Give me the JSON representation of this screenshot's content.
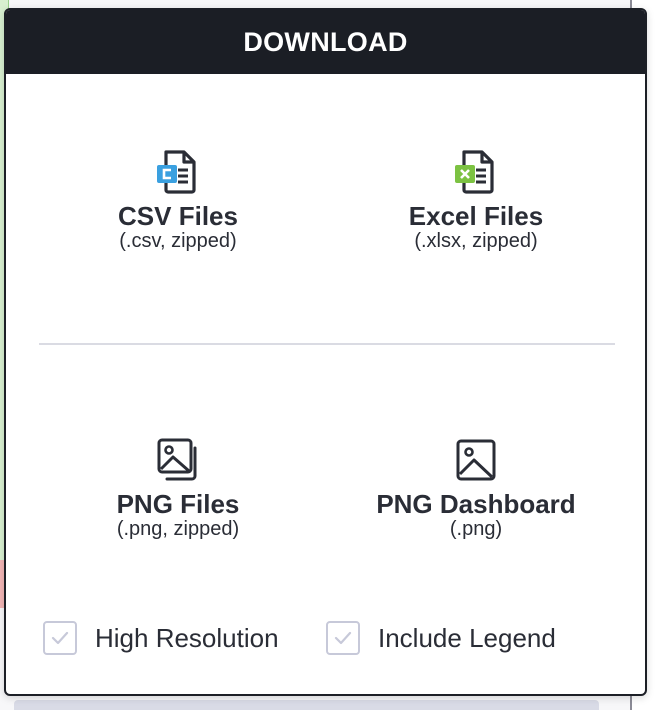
{
  "dialog": {
    "title": "DOWNLOAD",
    "options": [
      {
        "title": "CSV Files",
        "subtitle": "(.csv, zipped)",
        "icon": "csv-file-icon",
        "accent": "#3aa0e0"
      },
      {
        "title": "Excel Files",
        "subtitle": "(.xlsx, zipped)",
        "icon": "excel-file-icon",
        "accent": "#7cc242"
      },
      {
        "title": "PNG Files",
        "subtitle": "(.png, zipped)",
        "icon": "image-stack-icon"
      },
      {
        "title": "PNG Dashboard",
        "subtitle": "(.png)",
        "icon": "image-icon"
      }
    ],
    "checkboxes": [
      {
        "label": "High Resolution",
        "checked": false
      },
      {
        "label": "Include Legend",
        "checked": false
      }
    ]
  },
  "colors": {
    "header_bg": "#1b1e25",
    "text": "#2a2d36",
    "checkbox_border": "#c7c9d9",
    "divider": "#dadbe3"
  }
}
